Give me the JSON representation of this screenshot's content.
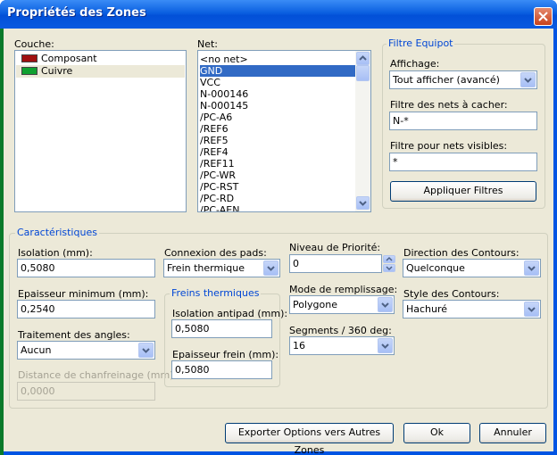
{
  "window": {
    "title": "Propriétés des Zones"
  },
  "couche": {
    "label": "Couche:",
    "items": [
      {
        "label": "Composant",
        "color": "#a01010"
      },
      {
        "label": "Cuivre",
        "color": "#10a030"
      }
    ]
  },
  "net": {
    "label": "Net:",
    "items": [
      "<no net>",
      "GND",
      "VCC",
      "N-000146",
      "N-000145",
      "/PC-A6",
      "/REF6",
      "/REF5",
      "/REF4",
      "/REF11",
      "/PC-WR",
      "/PC-RST",
      "/PC-RD",
      "/PC-AEN"
    ],
    "selected": "GND"
  },
  "filtre": {
    "title": "Filtre Equipot",
    "affichage_label": "Affichage:",
    "affichage_value": "Tout afficher (avancé)",
    "cacher_label": "Filtre des nets à cacher:",
    "cacher_value": "N-*",
    "visibles_label": "Filtre pour nets visibles:",
    "visibles_value": "*",
    "apply_button": "Appliquer Filtres"
  },
  "caracteristiques": {
    "title": "Caractéristiques",
    "isolation_label": "Isolation (mm):",
    "isolation_value": "0,5080",
    "epaisseur_min_label": "Epaisseur minimum (mm):",
    "epaisseur_min_value": "0,2540",
    "angles_label": "Traitement des angles:",
    "angles_value": "Aucun",
    "chanfrein_label": "Distance de chanfreinage (mm):",
    "chanfrein_value": "0,0000",
    "pads_label": "Connexion des pads:",
    "pads_value": "Frein thermique",
    "freins_title": "Freins thermiques",
    "antipad_label": "Isolation antipad (mm):",
    "antipad_value": "0,5080",
    "frein_label": "Epaisseur frein (mm):",
    "frein_value": "0,5080",
    "priorite_label": "Niveau de Priorité:",
    "priorite_value": "0",
    "remplissage_label": "Mode de remplissage:",
    "remplissage_value": "Polygone",
    "segments_label": "Segments / 360 deg:",
    "segments_value": "16",
    "direction_label": "Direction des Contours:",
    "direction_value": "Quelconque",
    "style_label": "Style des Contours:",
    "style_value": "Hachuré"
  },
  "buttons": {
    "export": "Exporter Options vers Autres Zones",
    "ok": "Ok",
    "cancel": "Annuler"
  }
}
